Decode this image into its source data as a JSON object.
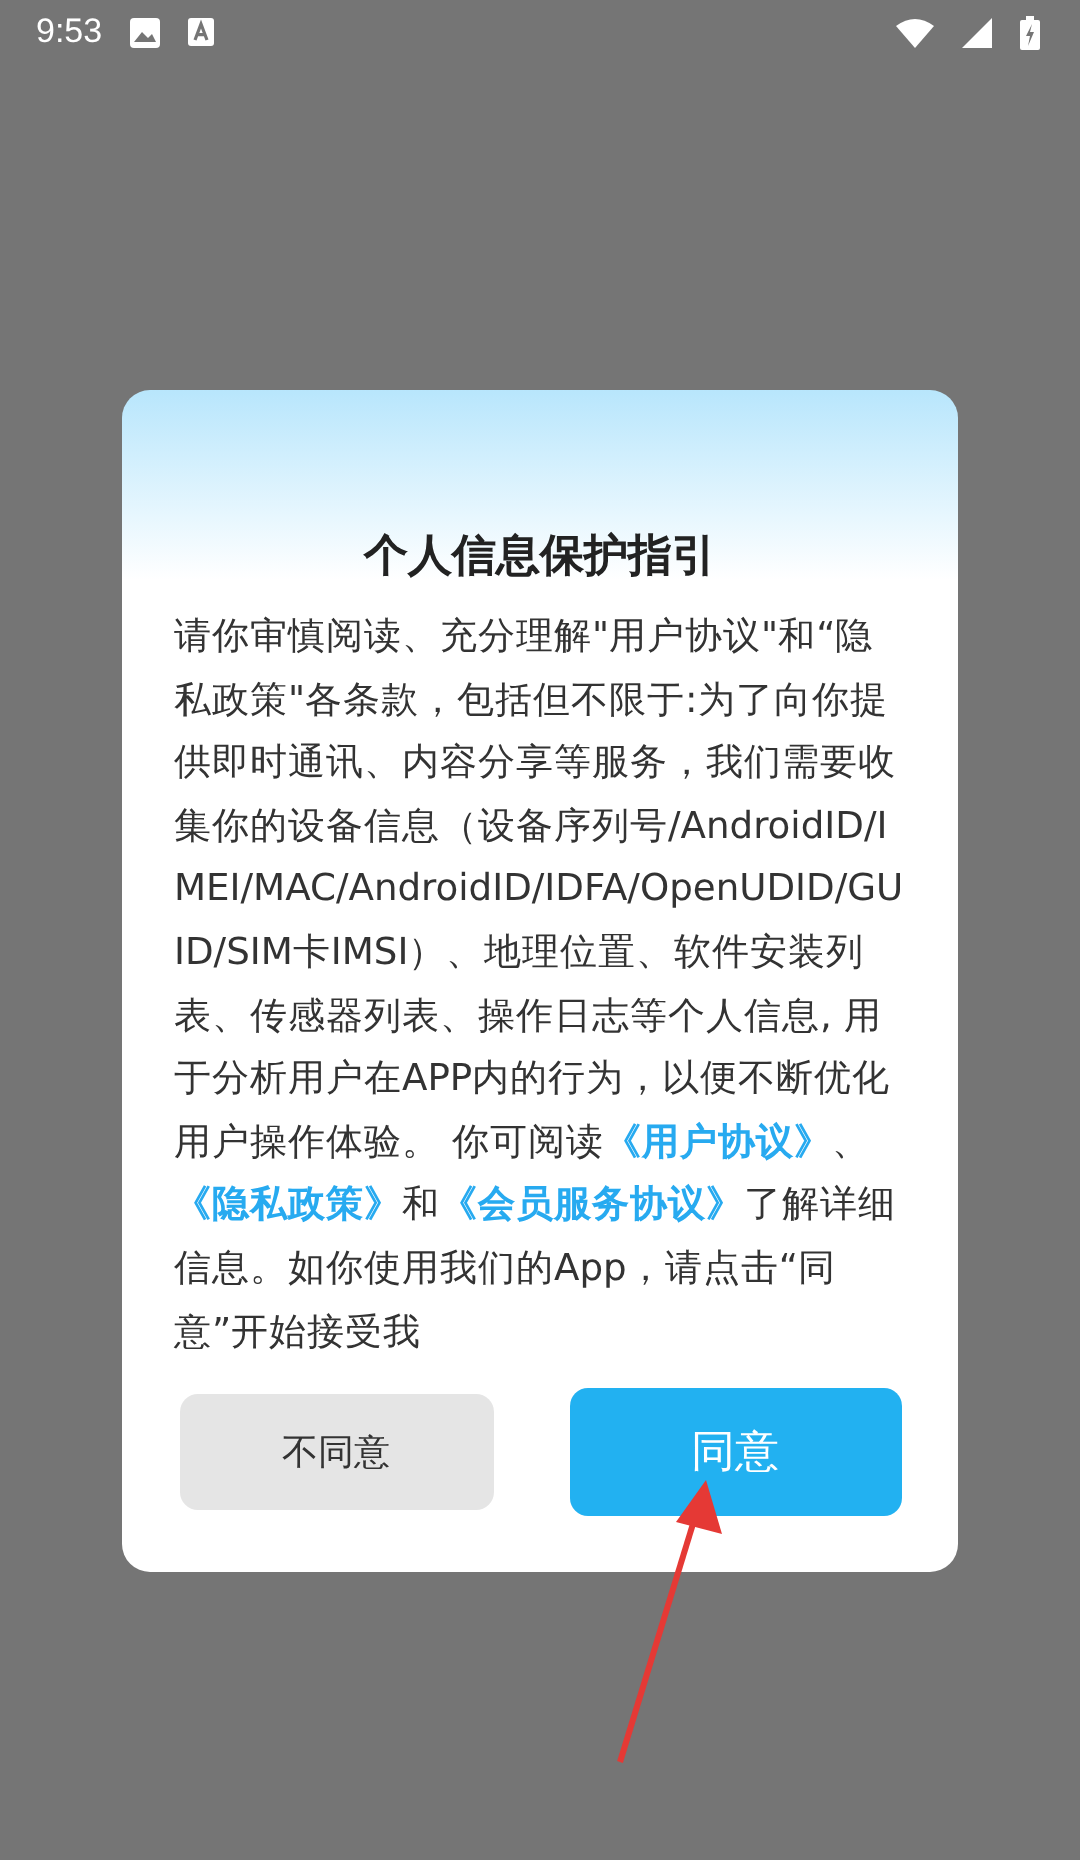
{
  "status_bar": {
    "time": "9:53"
  },
  "dialog": {
    "title": "个人信息保护指引",
    "body": [
      {
        "text": "请你审慎阅读、充分理解\"用户协议\"和“隐私政策\"各条款，包括但不限于:为了向你提供即时通讯、内容分享等服务，我们需要收集你的设备信息（设备序列号/AndroidID/IMEI/MAC/AndroidID/IDFA/OpenUDID/GUID/SIM卡IMSI）、地理位置、软件安装列表、传感器列表、操作日志等个人信息, 用于分析用户在APP内的行为，以便不断优化用户操作体验。 你可阅读",
        "link": false
      },
      {
        "text": "《用户协议》",
        "link": true
      },
      {
        "text": "、",
        "link": false
      },
      {
        "text": "《隐私政策》",
        "link": true
      },
      {
        "text": "和",
        "link": false
      },
      {
        "text": "《会员服务协议》",
        "link": true
      },
      {
        "text": "了解详细信息。如你使用我们的App，请点击“同意”开始接受我",
        "link": false
      }
    ],
    "buttons": [
      {
        "label": "不同意",
        "kind": "secondary"
      },
      {
        "label": "同意",
        "kind": "primary"
      }
    ]
  }
}
